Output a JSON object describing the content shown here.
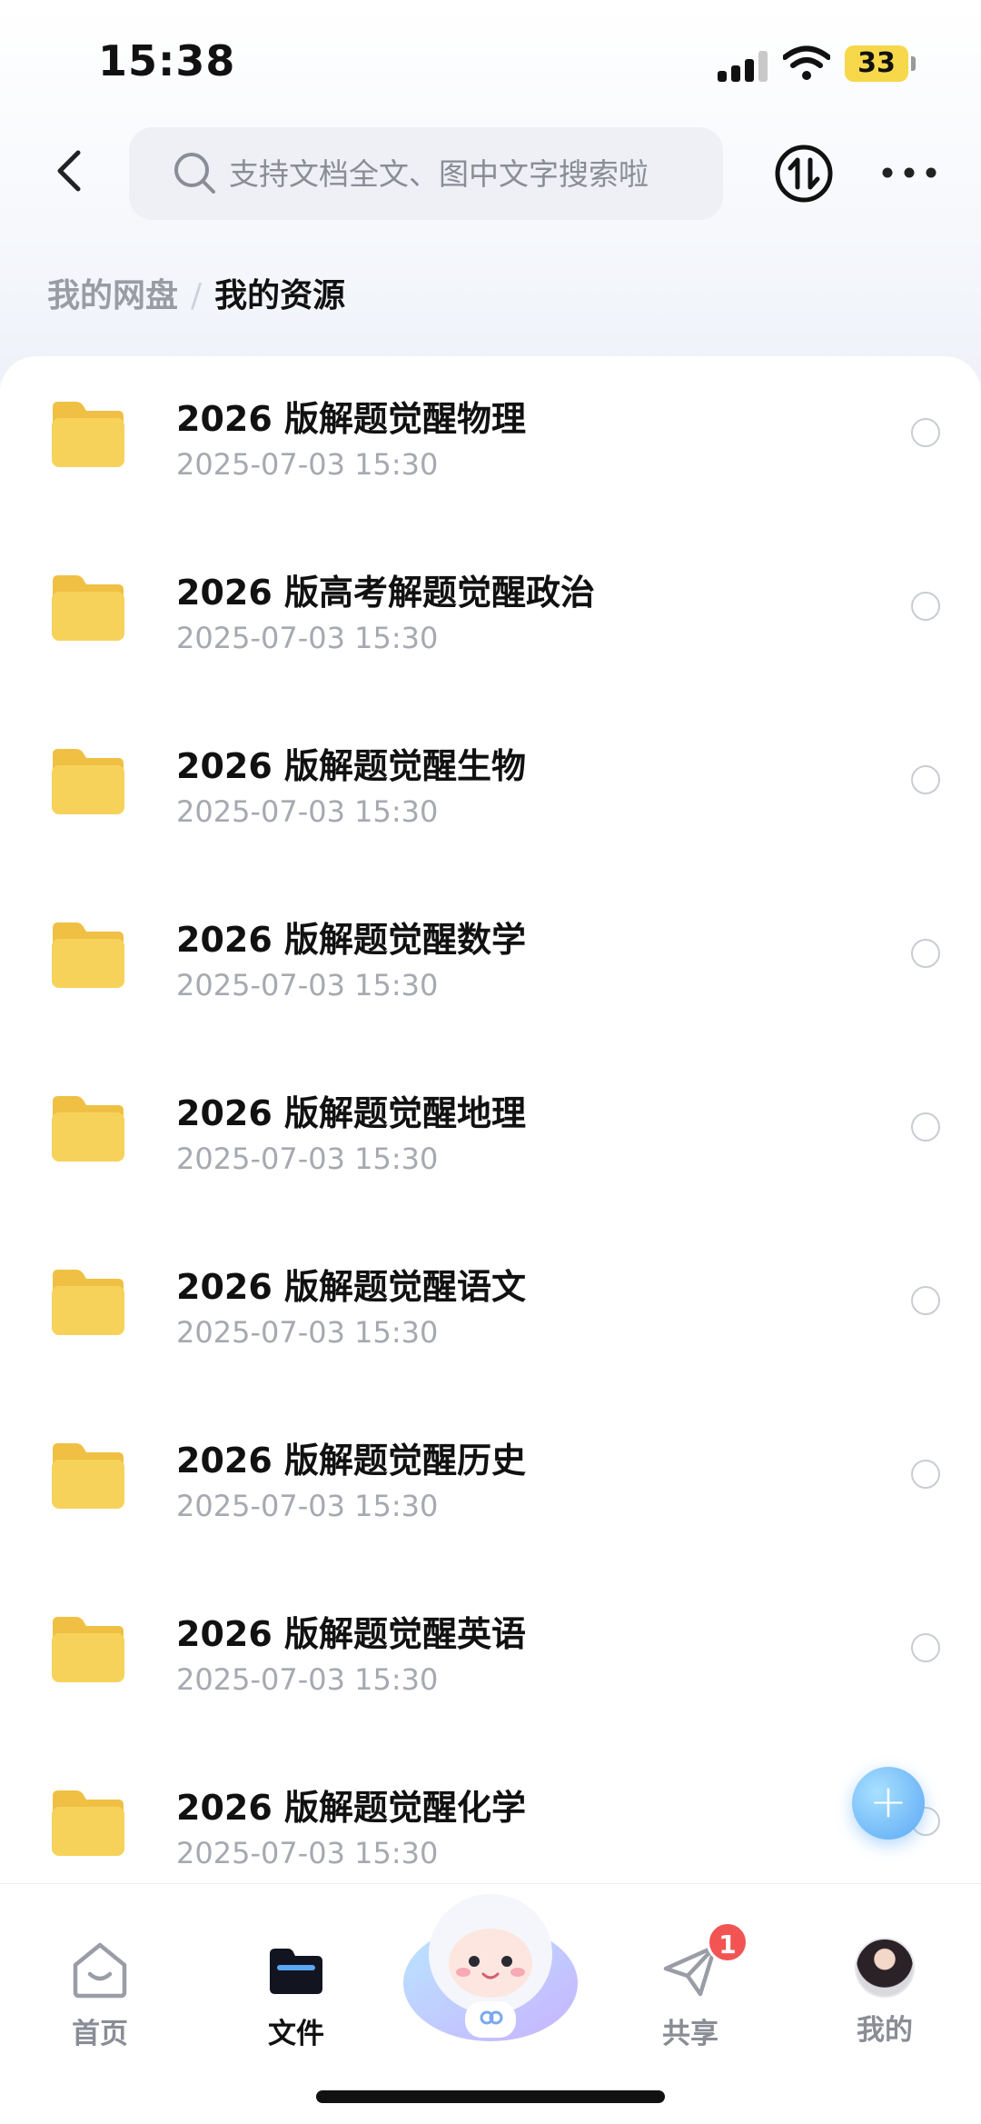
{
  "status_bar": {
    "time": "15:38",
    "battery": "33"
  },
  "header": {
    "search_placeholder": "支持文档全文、图中文字搜索啦"
  },
  "breadcrumb": {
    "parent": "我的网盘",
    "separator": "/",
    "current": "我的资源"
  },
  "files": [
    {
      "name": "2026 版解题觉醒物理",
      "date": "2025-07-03 15:30"
    },
    {
      "name": "2026 版高考解题觉醒政治",
      "date": "2025-07-03 15:30"
    },
    {
      "name": "2026 版解题觉醒生物",
      "date": "2025-07-03 15:30"
    },
    {
      "name": "2026 版解题觉醒数学",
      "date": "2025-07-03 15:30"
    },
    {
      "name": "2026 版解题觉醒地理",
      "date": "2025-07-03 15:30"
    },
    {
      "name": "2026 版解题觉醒语文",
      "date": "2025-07-03 15:30"
    },
    {
      "name": "2026 版解题觉醒历史",
      "date": "2025-07-03 15:30"
    },
    {
      "name": "2026 版解题觉醒英语",
      "date": "2025-07-03 15:30"
    },
    {
      "name": "2026 版解题觉醒化学",
      "date": "2025-07-03 15:30"
    }
  ],
  "fab": {
    "label": "+"
  },
  "bottom_nav": {
    "home": "首页",
    "files": "文件",
    "share": "共享",
    "share_badge": "1",
    "mine": "我的"
  },
  "colors": {
    "accent": "#5aa8f5",
    "folder": "#f7d25a",
    "badge": "#f25454",
    "battery": "#f6d84a"
  }
}
